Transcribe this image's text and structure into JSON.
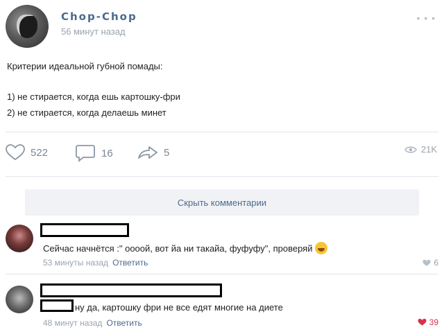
{
  "post": {
    "author": "Chop-Chop",
    "time": "56 минут назад",
    "more_icon": "more-dots-icon",
    "lines": [
      "Критерии идеальной губной помады:",
      "1) не стирается, когда ешь картошку-фри",
      "2) не стирается, когда делаешь минет"
    ]
  },
  "actions": {
    "likes": "522",
    "comments": "16",
    "shares": "5",
    "views": "21K"
  },
  "comments_toggle": "Скрыть комментарии",
  "comments": [
    {
      "text": "Сейчас начнётся :\" оооой, вот йа ни такайа, фуфуфу\", проверяй",
      "time": "53 минуты назад",
      "reply": "Ответить",
      "likes": "6",
      "liked": false
    },
    {
      "text": "ну да, картошку фри не все едят многие на диете",
      "time": "48 минут назад",
      "reply": "Ответить",
      "likes": "39",
      "liked": true
    }
  ],
  "colors": {
    "link": "#4d6a8c",
    "muted": "#9aa3ad",
    "liked": "#d5334a"
  }
}
